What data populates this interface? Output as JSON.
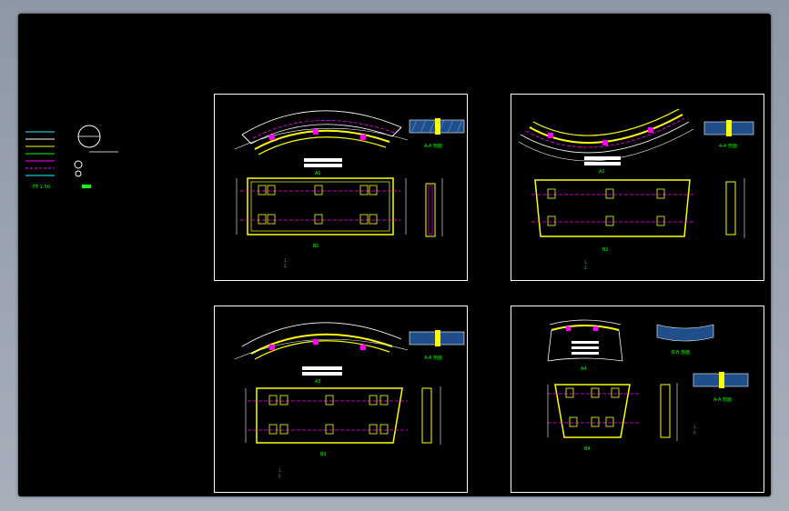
{
  "legend": {
    "scale": "PT 1:50",
    "circle_note": "R",
    "line_labels": [
      "1",
      "2",
      "3",
      "4",
      "5",
      "6",
      "7",
      "8"
    ]
  },
  "sheets": [
    {
      "id": "sheet-1",
      "plan_label": "A1",
      "elevation_label": "B1",
      "section_label": "A-A 剖面",
      "notes": [
        "1.",
        "2."
      ]
    },
    {
      "id": "sheet-2",
      "plan_label": "A2",
      "elevation_label": "B2",
      "section_label": "A-A 剖面",
      "notes": [
        "1.",
        "2."
      ]
    },
    {
      "id": "sheet-3",
      "plan_label": "A3",
      "elevation_label": "B3",
      "section_label": "A-A 剖面",
      "notes": [
        "1.",
        "2."
      ]
    },
    {
      "id": "sheet-4",
      "plan_label": "A4",
      "elevation_label": "B4",
      "section_label": "A-A 剖面",
      "section2_label": "B-B 剖面",
      "notes": [
        "1.",
        "2."
      ]
    }
  ],
  "colors": {
    "background": "#000000",
    "frame": "#ffffff",
    "outline": "#ffff00",
    "axis": "#ff00ff",
    "dimension": "#00ff00",
    "hatch": "#4a90d9"
  }
}
